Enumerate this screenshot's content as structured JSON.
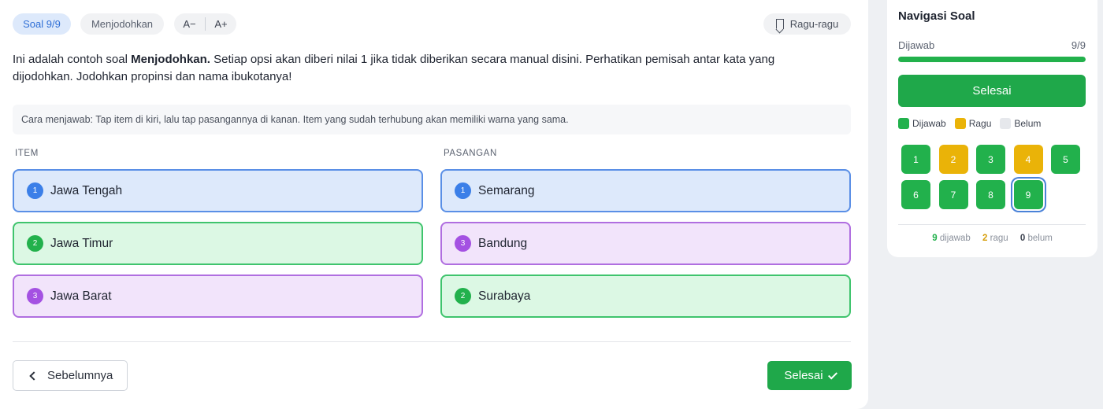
{
  "colors": {
    "answered": "#22b14c",
    "doubt": "#eab308",
    "unanswered": "#e6e8ec",
    "blue": "#3b7fe8",
    "purple": "#a451e2"
  },
  "topbar": {
    "soal_label": "Soal 9/9",
    "type_label": "Menjodohkan",
    "font_decrease": "A−",
    "font_increase": "A+",
    "ragu_label": "Ragu-ragu"
  },
  "question": {
    "intro": "Ini adalah contoh soal ",
    "bold": "Menjodohkan.",
    "rest": " Setiap opsi akan diberi nilai 1 jika tidak diberikan secara manual disini. Perhatikan pemisah antar kata yang dijodohkan. Jodohkan propinsi dan nama ibukotanya!"
  },
  "hint": {
    "label": "Cara menjawab:",
    "text": " Tap item di kiri, lalu tap pasangannya di kanan. Item yang sudah terhubung akan memiliki warna yang sama."
  },
  "columns": {
    "left": "ITEM",
    "right": "PASANGAN"
  },
  "items": [
    {
      "num": "1",
      "label": "Jawa Tengah",
      "color": "blue"
    },
    {
      "num": "2",
      "label": "Jawa Timur",
      "color": "green"
    },
    {
      "num": "3",
      "label": "Jawa Barat",
      "color": "purple"
    }
  ],
  "pairs": [
    {
      "num": "1",
      "label": "Semarang",
      "color": "blue"
    },
    {
      "num": "3",
      "label": "Bandung",
      "color": "purple"
    },
    {
      "num": "2",
      "label": "Surabaya",
      "color": "green"
    }
  ],
  "footer": {
    "prev_label": "Sebelumnya",
    "finish_label": "Selesai"
  },
  "sidebar": {
    "title": "Navigasi Soal",
    "answered_label": "Dijawab",
    "answered_count": "9/9",
    "progress": 1.0,
    "finish_label": "Selesai",
    "legend": {
      "answered": "Dijawab",
      "doubt": "Ragu",
      "empty": "Belum"
    },
    "questions": [
      {
        "num": "1",
        "state": "answered"
      },
      {
        "num": "2",
        "state": "doubt"
      },
      {
        "num": "3",
        "state": "answered"
      },
      {
        "num": "4",
        "state": "doubt"
      },
      {
        "num": "5",
        "state": "answered"
      },
      {
        "num": "6",
        "state": "answered"
      },
      {
        "num": "7",
        "state": "answered"
      },
      {
        "num": "8",
        "state": "answered"
      },
      {
        "num": "9",
        "state": "answered",
        "current": true
      }
    ],
    "summary": {
      "answered_n": "9",
      "answered_t": "dijawab",
      "doubt_n": "2",
      "doubt_t": "ragu",
      "empty_n": "0",
      "empty_t": "belum"
    }
  }
}
